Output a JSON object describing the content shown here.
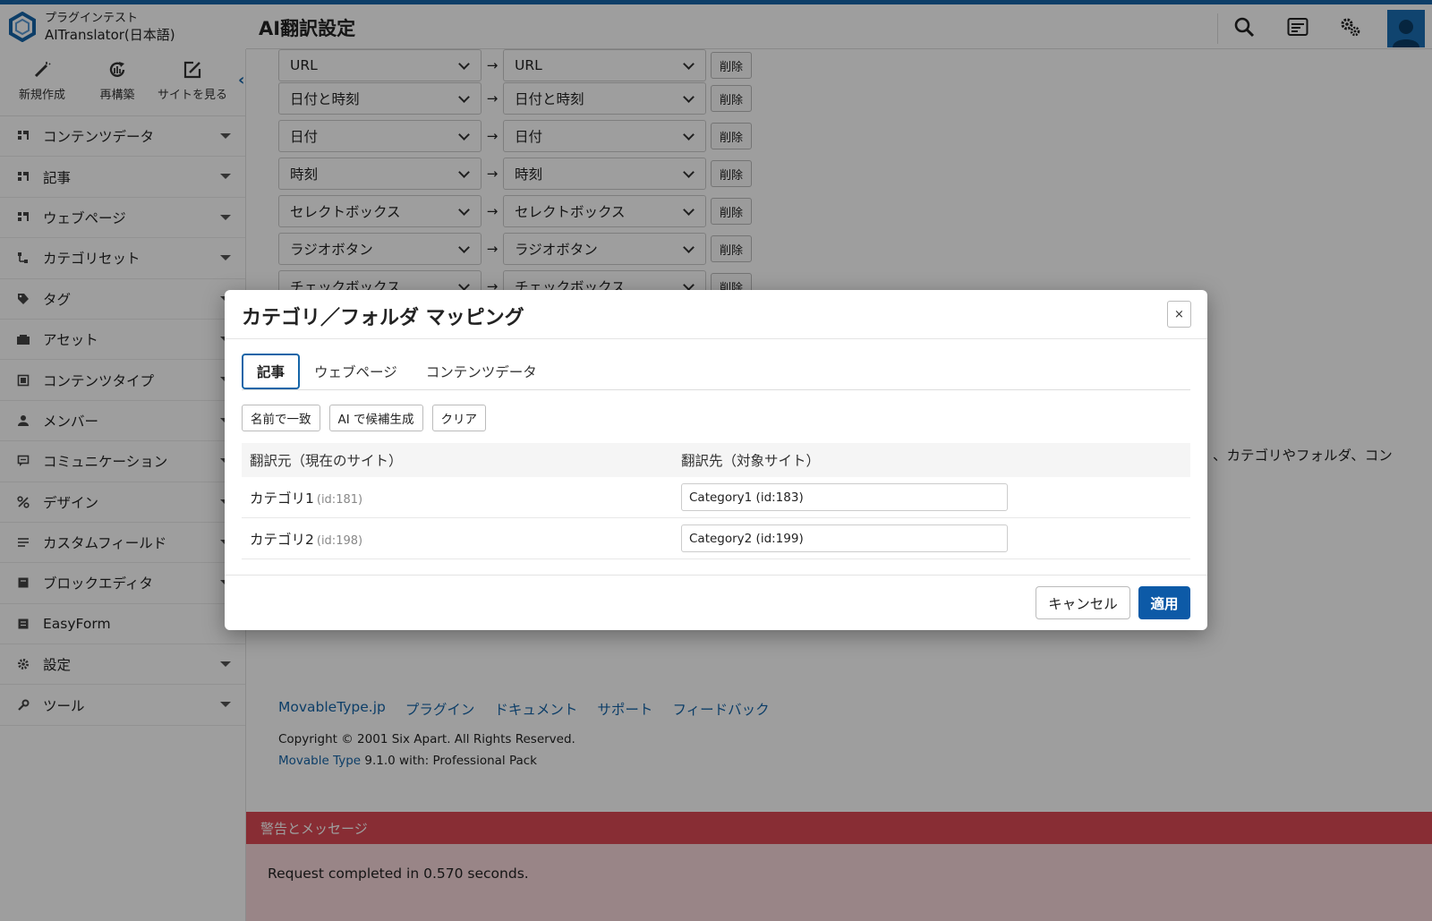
{
  "brand": {
    "subtitle": "プラグインテスト",
    "site_name": "AITranslator(日本語)"
  },
  "header": {
    "title": "AI翻訳設定",
    "icons": [
      "search-icon",
      "list-icon",
      "gears-icon",
      "user-icon"
    ]
  },
  "sidebar": {
    "quick_actions": [
      {
        "label": "新規作成",
        "icon": "pen-icon"
      },
      {
        "label": "再構築",
        "icon": "rebuild-icon"
      },
      {
        "label": "サイトを見る",
        "icon": "external-edit-icon"
      }
    ],
    "collapse_icon": "chevron-left-icon",
    "items": [
      {
        "label": "コンテンツデータ",
        "icon": "grid-icon"
      },
      {
        "label": "記事",
        "icon": "grid-icon"
      },
      {
        "label": "ウェブページ",
        "icon": "grid-icon"
      },
      {
        "label": "カテゴリセット",
        "icon": "tree-icon"
      },
      {
        "label": "タグ",
        "icon": "tag-icon"
      },
      {
        "label": "アセット",
        "icon": "folder-icon"
      },
      {
        "label": "コンテンツタイプ",
        "icon": "window-icon"
      },
      {
        "label": "メンバー",
        "icon": "person-icon"
      },
      {
        "label": "コミュニケーション",
        "icon": "comment-icon"
      },
      {
        "label": "デザイン",
        "icon": "percent-icon"
      },
      {
        "label": "カスタムフィールド",
        "icon": "lines-icon"
      },
      {
        "label": "ブロックエディタ",
        "icon": "block-icon"
      },
      {
        "label": "EasyForm",
        "icon": "form-icon"
      },
      {
        "label": "設定",
        "icon": "gear-icon"
      },
      {
        "label": "ツール",
        "icon": "wrench-icon"
      }
    ]
  },
  "field_mappings": {
    "arrow": "→",
    "delete_label": "削除",
    "rows": [
      {
        "source": "URL",
        "target": "URL"
      },
      {
        "source": "日付と時刻",
        "target": "日付と時刻"
      },
      {
        "source": "日付",
        "target": "日付"
      },
      {
        "source": "時刻",
        "target": "時刻"
      },
      {
        "source": "セレクトボックス",
        "target": "セレクトボックス"
      },
      {
        "source": "ラジオボタン",
        "target": "ラジオボタン"
      },
      {
        "source": "チェックボックス",
        "target": "チェックボックス"
      }
    ]
  },
  "side_text": "、カテゴリやフォルダ、コン",
  "footer": {
    "links": [
      "MovableType.jp",
      "プラグイン",
      "ドキュメント",
      "サポート",
      "フィードバック"
    ],
    "copyright": "Copyright © 2001 Six Apart. All Rights Reserved.",
    "version_link": "Movable Type",
    "version_text": " 9.1.0 with: Professional Pack"
  },
  "alert": {
    "title": "警告とメッセージ",
    "message": "Request completed in 0.570 seconds."
  },
  "modal": {
    "title": "カテゴリ／フォルダ マッピング",
    "close_label": "×",
    "tabs": [
      {
        "label": "記事",
        "active": true
      },
      {
        "label": "ウェブページ",
        "active": false
      },
      {
        "label": "コンテンツデータ",
        "active": false
      }
    ],
    "toolbar": {
      "match_by_name": "名前で一致",
      "ai_suggest": "AI で候補生成",
      "clear": "クリア"
    },
    "table": {
      "col_source": "翻訳元（現在のサイト）",
      "col_target": "翻訳先（対象サイト）",
      "rows": [
        {
          "source_name": "カテゴリ1",
          "source_id": "(id:181)",
          "target_value": "Category1 (id:183)"
        },
        {
          "source_name": "カテゴリ2",
          "source_id": "(id:198)",
          "target_value": "Category2 (id:199)"
        }
      ]
    },
    "cancel_label": "キャンセル",
    "apply_label": "適用"
  },
  "colors": {
    "accent": "#1565a8",
    "primary_button": "#0d5aa7",
    "alert_header": "#dc4a55",
    "alert_body": "#f7d7da"
  }
}
